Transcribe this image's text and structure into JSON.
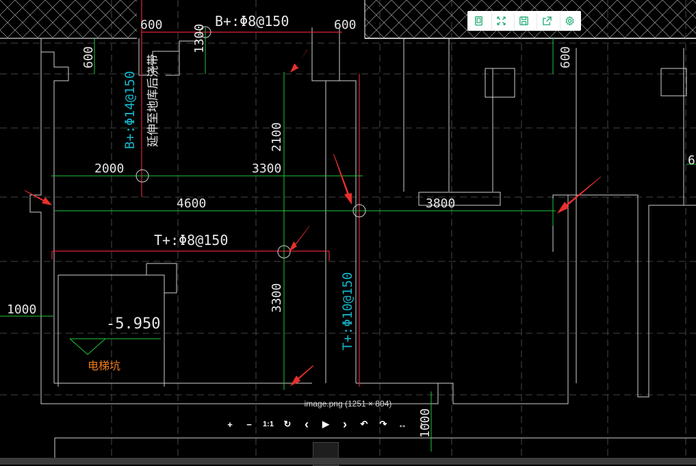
{
  "caption": "image.png (1251 × 804)",
  "toolbar": [
    {
      "name": "fit-page-icon",
      "title": ""
    },
    {
      "name": "expand-icon",
      "title": ""
    },
    {
      "name": "save-icon",
      "title": ""
    },
    {
      "name": "share-icon",
      "title": ""
    },
    {
      "name": "settings-icon",
      "title": ""
    }
  ],
  "viewer_controls": [
    {
      "name": "zoom-in-button",
      "label": "+"
    },
    {
      "name": "zoom-out-button",
      "label": "−"
    },
    {
      "name": "actual-size-button",
      "label": "1:1"
    },
    {
      "name": "rotate-button",
      "label": "↻"
    },
    {
      "name": "prev-button",
      "label": "‹"
    },
    {
      "name": "play-button",
      "label": "▶"
    },
    {
      "name": "next-button",
      "label": "›"
    },
    {
      "name": "rotate-left-button",
      "label": "↶"
    },
    {
      "name": "rotate-right-button",
      "label": "↷"
    },
    {
      "name": "flip-horizontal-button",
      "label": "↔"
    },
    {
      "name": "flip-vertical-button",
      "label": "↕"
    }
  ],
  "drawing": {
    "dims": {
      "d600_tl": "600",
      "d600_tc": "600",
      "d600_left": "600",
      "d600_right": "600",
      "d1300": "1300",
      "d2100": "2100",
      "d2000": "2000",
      "d3300_h": "3300",
      "d4600": "4600",
      "d3800": "3800",
      "d3300_v": "3300",
      "d1000_left": "1000",
      "d1000_bottom": "1000",
      "d6_right": "6"
    },
    "labels": {
      "rebar_top": "B+:Φ8@150",
      "rebar_vertical": "B+:Φ14@150",
      "note_vertical": "延伸至地库后浇带",
      "rebar_mid": "T+:Φ8@150",
      "rebar_vertical2": "T+:Φ10@150",
      "elevation": "-5.950",
      "pit": "电梯坑"
    }
  }
}
